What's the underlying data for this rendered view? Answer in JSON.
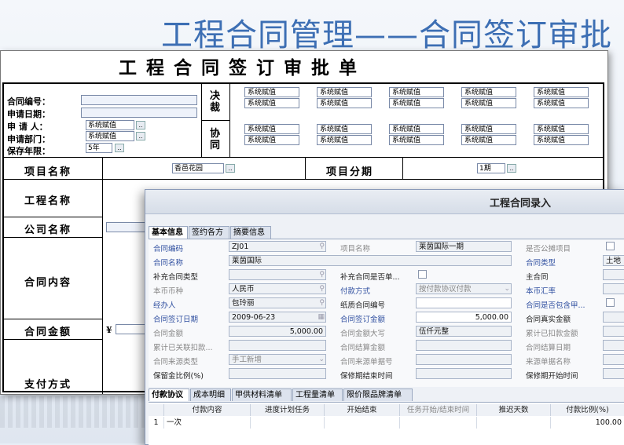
{
  "slide": {
    "title": "工程合同管理——合同签订审批"
  },
  "form": {
    "title": "工程合同签订审批单",
    "labels": {
      "contract_no": "合同编号：",
      "apply_date": "申请日期：",
      "applicant": "申 请 人：",
      "department": "申请部门：",
      "retention": "保存年限："
    },
    "applicant_value": "系统赋值",
    "department_value": "系统赋值",
    "retention_value": "5年",
    "decide_label": "决裁",
    "cosign_label": "协同",
    "sys_value": "系统赋值",
    "project_name_label": "项目名称",
    "project_name_value": "香邑花园",
    "project_stage_label": "项目分期",
    "project_stage_value": "1期",
    "engineering_name_label": "工程名称",
    "company_name_label": "公司名称",
    "contract_content_label": "合同内容",
    "contract_amount_label": "合同金额",
    "currency_symbol": "¥",
    "payment_method_label": "支付方式"
  },
  "dialog": {
    "title": "工程合同录入",
    "tabs": [
      "基本信息",
      "签约各方",
      "摘要信息"
    ],
    "fields": {
      "contract_code_label": "合同编码",
      "contract_code_value": "ZJ01",
      "project_name_label": "项目名称",
      "project_name_value": "莱茵国际一期",
      "shared_project_label": "是否公摊项目",
      "contract_name_label": "合同名称",
      "contract_name_value": "莱茵国际",
      "contract_type_label": "合同类型",
      "contract_type_value": "土地",
      "supp_type_label": "补充合同类型",
      "is_supp_label": "补充合同是否单...",
      "main_contract_label": "主合同",
      "currency_label": "本币币种",
      "currency_value": "人民币",
      "pay_method_label": "付款方式",
      "pay_method_value": "按付款协议付款",
      "exchange_rate_label": "本币汇率",
      "handler_label": "经办人",
      "handler_value": "包玲丽",
      "paper_no_label": "纸质合同编号",
      "includes_label": "合同是否包含甲...",
      "sign_date_label": "合同签订日期",
      "sign_date_value": "2009-06-23",
      "sign_amount_label": "合同签订金额",
      "sign_amount_value": "5,000.00",
      "real_amount_label": "合同真实金额",
      "contract_amount_label": "合同金额",
      "contract_amount_value": "5,000.00",
      "amount_upper_label": "合同金额大写",
      "amount_upper_value": "伍仟元整",
      "deducted_label": "累计已扣款金额",
      "linked_label": "累计已关联扣款...",
      "settle_amount_label": "合同结算金额",
      "settle_date_label": "合同结算日期",
      "source_type_label": "合同来源类型",
      "source_type_value": "手工新增",
      "source_no_label": "合同来源单据号",
      "source_name_label": "来源单据名称",
      "retention_ratio_label": "保留金比例(%)",
      "warranty_end_label": "保修期结束时间",
      "warranty_start_label": "保修期开始时间"
    },
    "bottom_tabs": [
      "付款协议",
      "成本明细",
      "甲供材料清单",
      "工程量清单",
      "限价限品牌清单"
    ],
    "table": {
      "columns": [
        "",
        "付款内容",
        "进度计划任务",
        "开始结束",
        "任务开始/结束时间",
        "推迟天数",
        "付款比例(%)"
      ],
      "rows": [
        [
          "1",
          "一次",
          "",
          "",
          "",
          "",
          "100.00"
        ]
      ]
    }
  }
}
